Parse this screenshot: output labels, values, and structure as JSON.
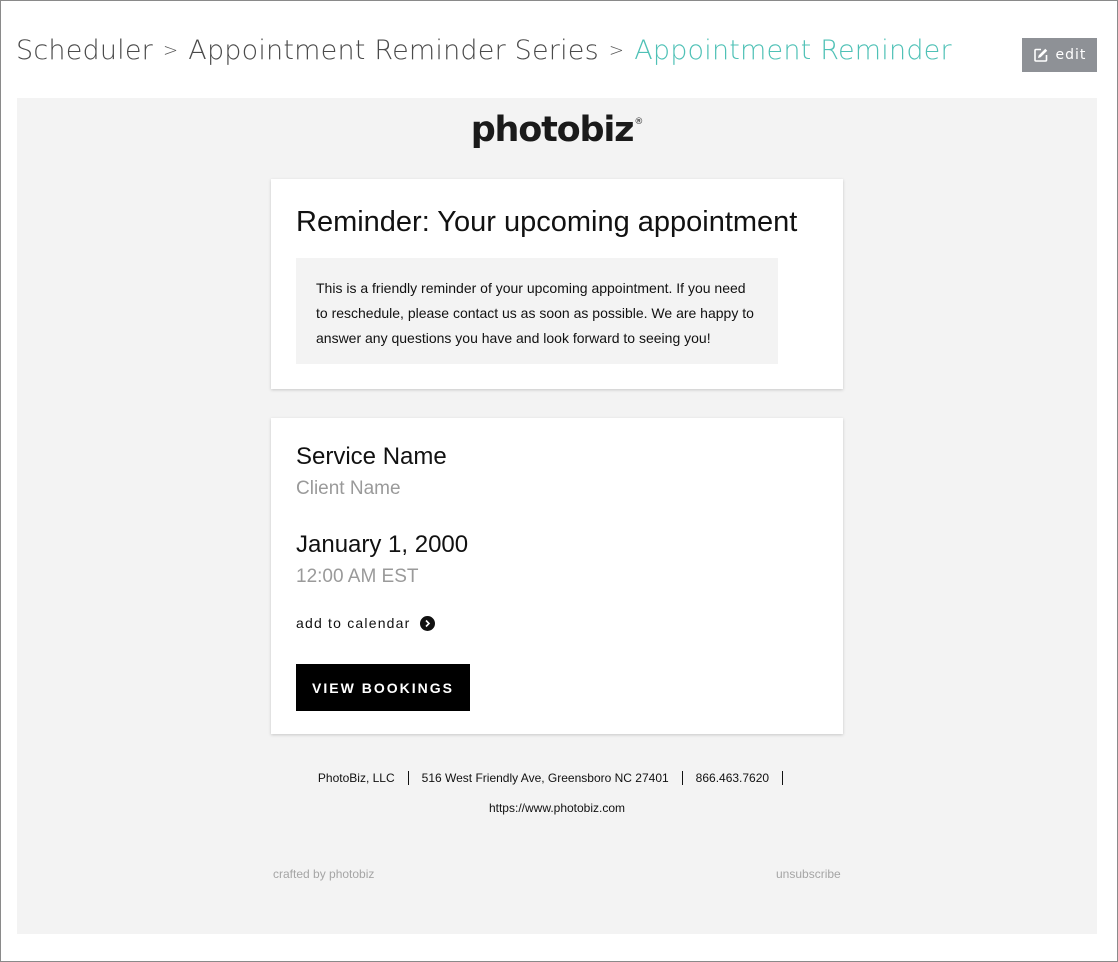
{
  "breadcrumb": {
    "items": [
      "Scheduler",
      "Appointment Reminder Series",
      "Appointment Reminder"
    ],
    "separator": ">"
  },
  "toolbar": {
    "edit_label": "edit",
    "edit_icon": "edit-icon"
  },
  "email": {
    "logo_text": "photobiz",
    "logo_mark": "®",
    "heading": "Reminder: Your upcoming appointment",
    "message": "This is a friendly reminder of your upcoming appointment. If you need to reschedule, please contact us as soon as possible. We are happy to answer any questions you have and look forward to seeing you!",
    "service_name": "Service Name",
    "client_name": "Client Name",
    "date": "January 1, 2000",
    "time": "12:00 AM EST",
    "add_to_calendar": "add to calendar",
    "view_bookings": "VIEW BOOKINGS",
    "footer": {
      "company": "PhotoBiz, LLC",
      "address": "516 West Friendly Ave, Greensboro NC 27401",
      "phone": "866.463.7620",
      "url": "https://www.photobiz.com",
      "crafted": "crafted by photobiz",
      "unsubscribe": "unsubscribe"
    }
  },
  "colors": {
    "accent": "#4fc1b6",
    "edit_button": "#8e9196",
    "preview_bg": "#f3f3f3"
  }
}
